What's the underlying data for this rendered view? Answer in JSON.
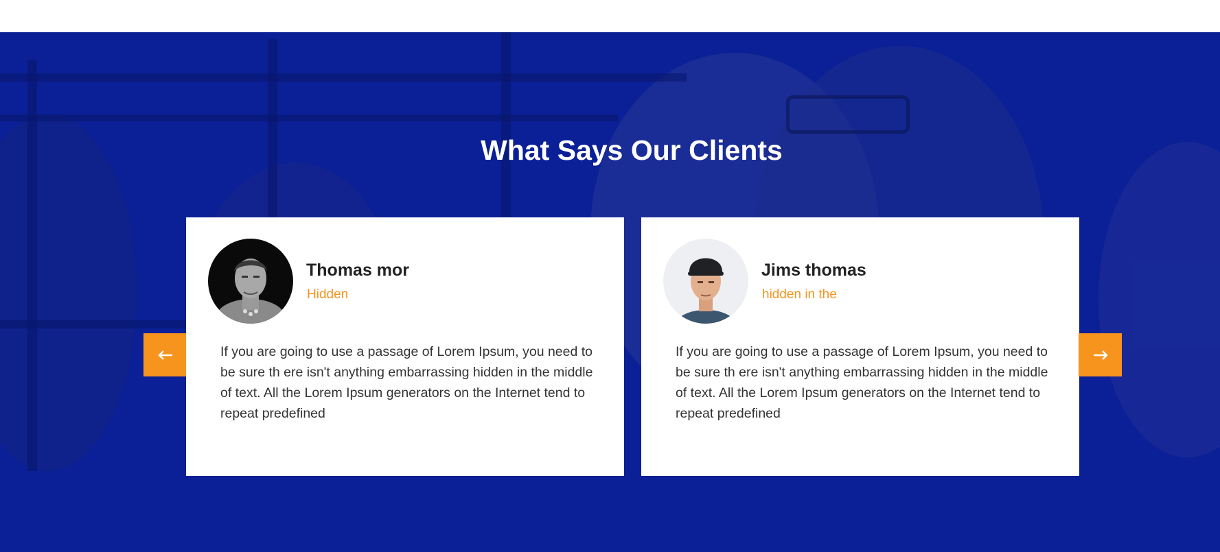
{
  "section": {
    "title": "What Says Our Clients"
  },
  "testimonials": [
    {
      "name": "Thomas mor",
      "role": "Hidden",
      "avatar_icon": "person-portrait-monochrome",
      "text": "If you are going to use a passage of Lorem Ipsum, you need to be sure th ere isn't anything embarrassing hidden in the middle of text. All the Lorem Ipsum generators on the Internet tend to repeat predefined"
    },
    {
      "name": "Jims thomas",
      "role": "hidden in the",
      "avatar_icon": "person-portrait-cap",
      "text": "If you are going to use a passage of Lorem Ipsum, you need to be sure th ere isn't anything embarrassing hidden in the middle of text. All the Lorem Ipsum generators on the Internet tend to repeat predefined"
    }
  ],
  "navigation": {
    "prev_icon": "arrow-left-icon",
    "next_icon": "arrow-right-icon"
  },
  "colors": {
    "background": "#0b1f96",
    "accent": "#f7941d",
    "card": "#ffffff",
    "name_text": "#222222",
    "body_text": "#333333"
  }
}
